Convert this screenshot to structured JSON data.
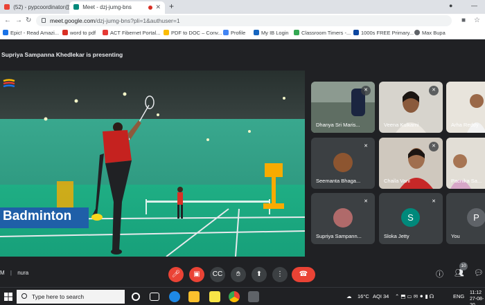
{
  "browser": {
    "tabs": [
      {
        "label": "(52) - pypcoordinator@the",
        "active": false
      },
      {
        "label": "Meet - dzj-jumg-bns",
        "active": true
      }
    ],
    "url_host": "meet.google.com",
    "url_path": "/dzj-jumg-bns?pli=1&authuser=1",
    "bookmarks": [
      "Epic! - Read Amazi...",
      "word to pdf",
      "ACT Fibernet Portal...",
      "PDF to DOC – Conv...",
      "Profile",
      "My IB Login",
      "Classroom Timers -...",
      "1000s FREE Primary...",
      "Max Bupa"
    ]
  },
  "meet": {
    "presenting_text": "Supriya Sampanna Khedlekar is presenting",
    "slide_title": "Badminton",
    "meeting_label": "M",
    "meeting_name": "nura",
    "participant_count": "10",
    "participants": [
      {
        "name": "Dhanya Sri Maris..."
      },
      {
        "name": "Veena Kulkarni"
      },
      {
        "name": "Arha Reddy"
      },
      {
        "name": "Seemanta Bhaga..."
      },
      {
        "name": "Chaila Vani"
      },
      {
        "name": "Pacnika Sa..."
      },
      {
        "name": "Supriya Sampann..."
      },
      {
        "name": "Sloka Jetty",
        "initial": "S"
      },
      {
        "name": "You",
        "initial": "P"
      }
    ]
  },
  "taskbar": {
    "search_placeholder": "Type here to search",
    "weather": "16°C",
    "aqi": "AQI 34",
    "language": "ENG",
    "time": "11:12",
    "date": "27-08-20"
  }
}
